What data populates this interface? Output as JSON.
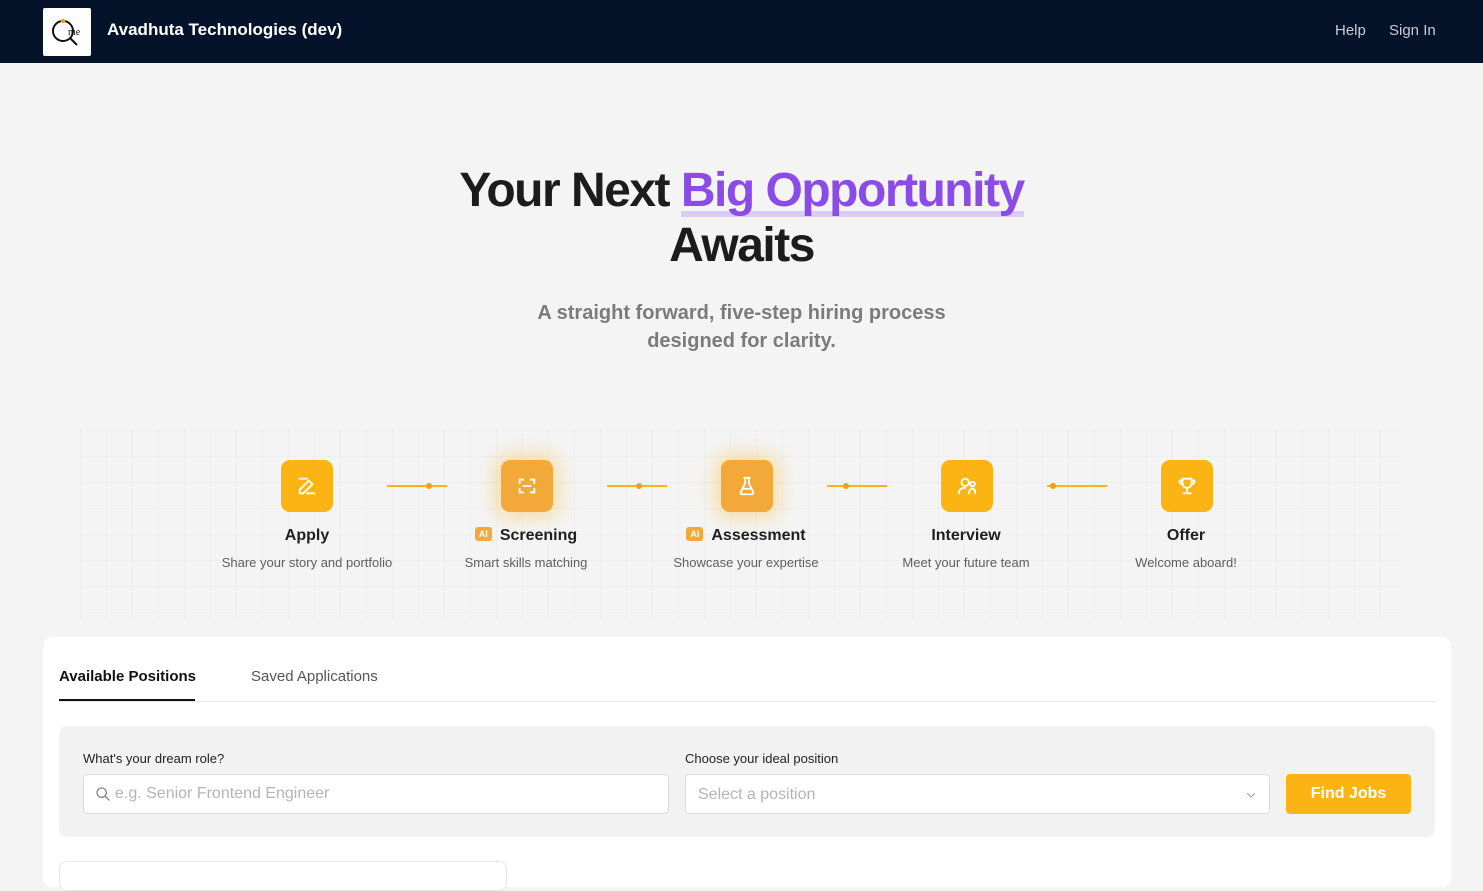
{
  "header": {
    "company_name": "Avadhuta Technologies (dev)",
    "logo_text": "me",
    "nav": {
      "help": "Help",
      "sign_in": "Sign In"
    }
  },
  "hero": {
    "title_prefix": "Your Next",
    "title_accent": "Big Opportunity",
    "title_line2": "Awaits",
    "subtitle_line1": "A straight forward, five-step hiring process",
    "subtitle_line2": "designed for clarity."
  },
  "steps": [
    {
      "title": "Apply",
      "description": "Share your story and portfolio",
      "icon": "edit-icon",
      "ai": false
    },
    {
      "title": "Screening",
      "description": "Smart skills matching",
      "icon": "scan-icon",
      "ai": true
    },
    {
      "title": "Assessment",
      "description": "Showcase your expertise",
      "icon": "flask-icon",
      "ai": true
    },
    {
      "title": "Interview",
      "description": "Meet your future team",
      "icon": "people-icon",
      "ai": false
    },
    {
      "title": "Offer",
      "description": "Welcome aboard!",
      "icon": "trophy-icon",
      "ai": false
    }
  ],
  "ai_badge_label": "AI",
  "tabs": {
    "active": "Available Positions",
    "inactive": "Saved Applications"
  },
  "search": {
    "role_label": "What's your dream role?",
    "role_placeholder": "e.g. Senior Frontend Engineer",
    "position_label": "Choose your ideal position",
    "position_placeholder": "Select a position",
    "submit_label": "Find Jobs"
  },
  "colors": {
    "header_bg": "#04122a",
    "accent_purple": "#8a4be6",
    "step_orange": "#fcb414",
    "page_bg": "#f4f4f4"
  }
}
